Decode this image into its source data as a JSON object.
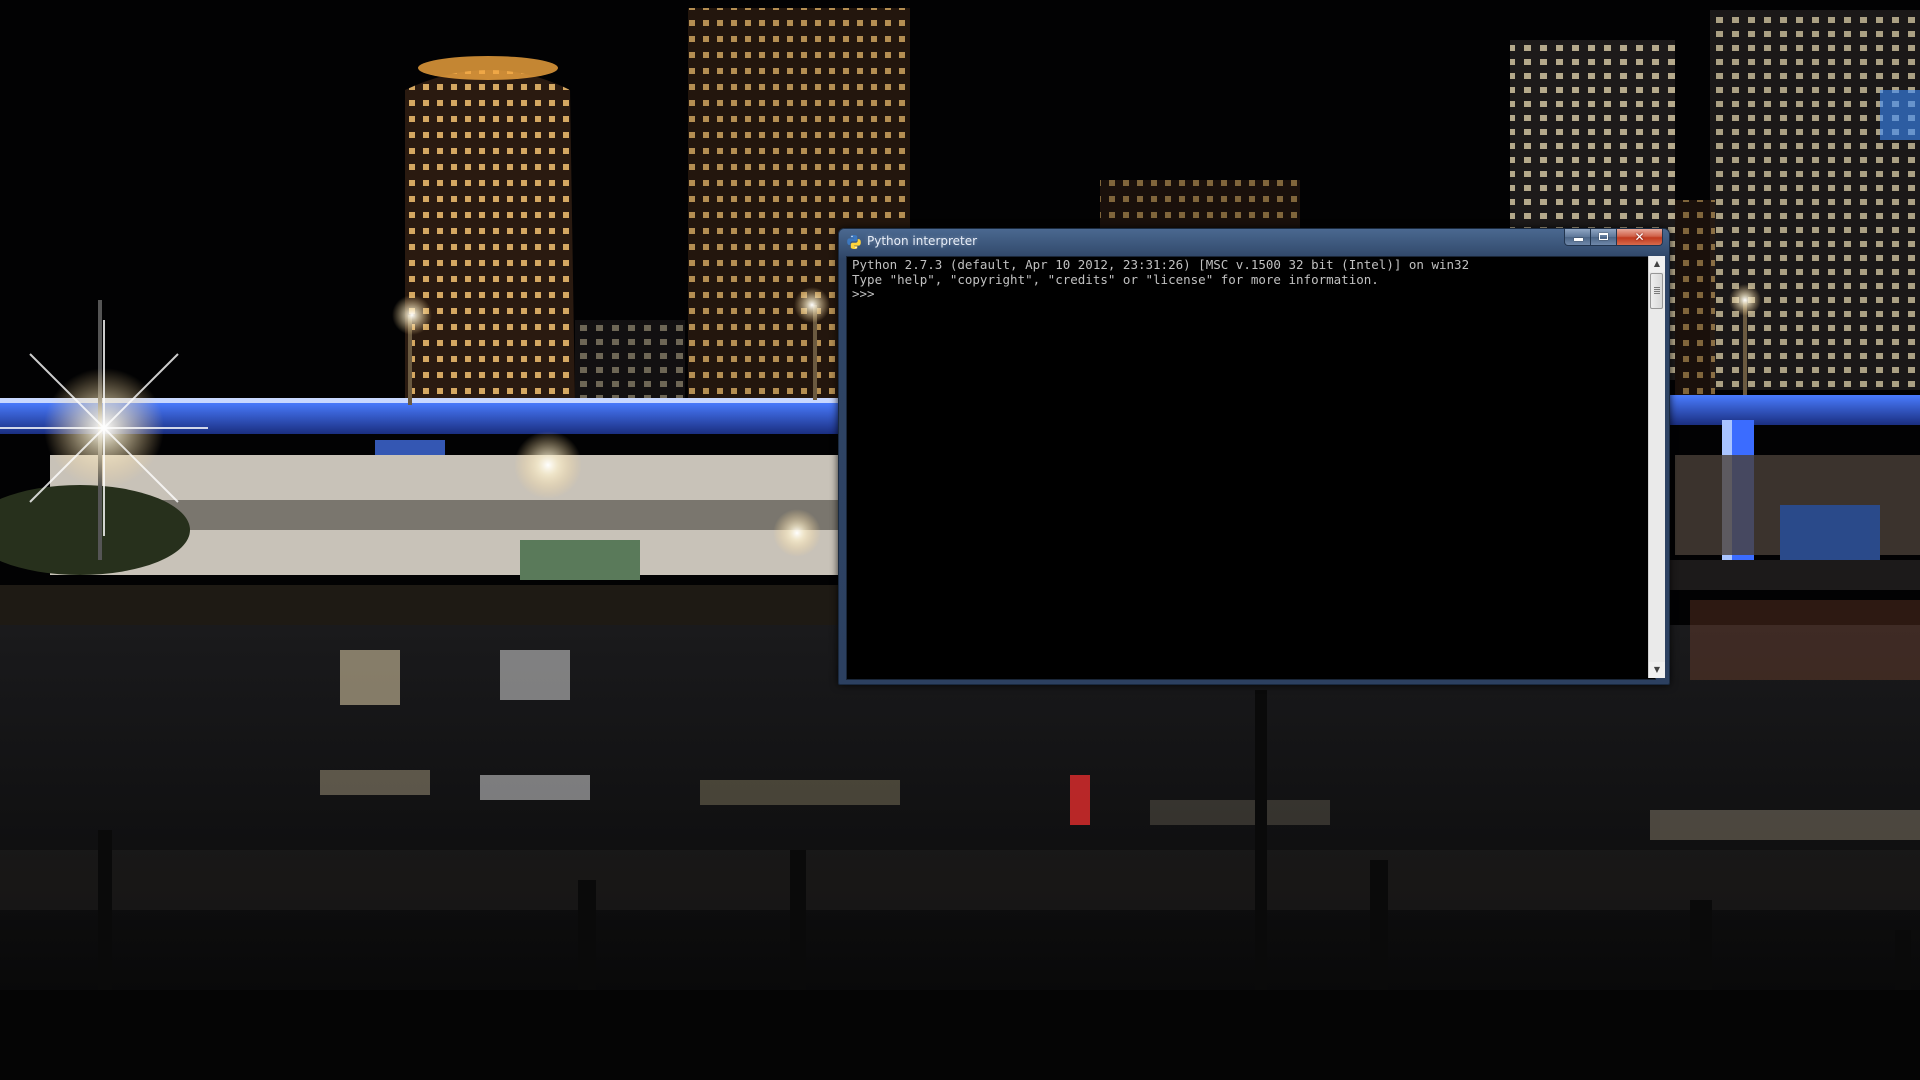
{
  "window": {
    "title": "Python interpreter",
    "icon": "python-icon",
    "buttons": {
      "minimize": "minimize-icon",
      "maximize": "maximize-icon",
      "close": "close-icon",
      "close_glyph": "✕"
    }
  },
  "console": {
    "lines": [
      "Python 2.7.3 (default, Apr 10 2012, 23:31:26) [MSC v.1500 32 bit (Intel)] on win32",
      "Type \"help\", \"copyright\", \"credits\" or \"license\" for more information.",
      ">>> "
    ],
    "text_color": "#c0c0c0",
    "background_color": "#000000"
  },
  "scrollbar": {
    "up_glyph": "▲",
    "down_glyph": "▼"
  },
  "colors": {
    "title_bar": "#3a5478",
    "close_button": "#c0391e",
    "wallpaper_sky": "#020203"
  }
}
